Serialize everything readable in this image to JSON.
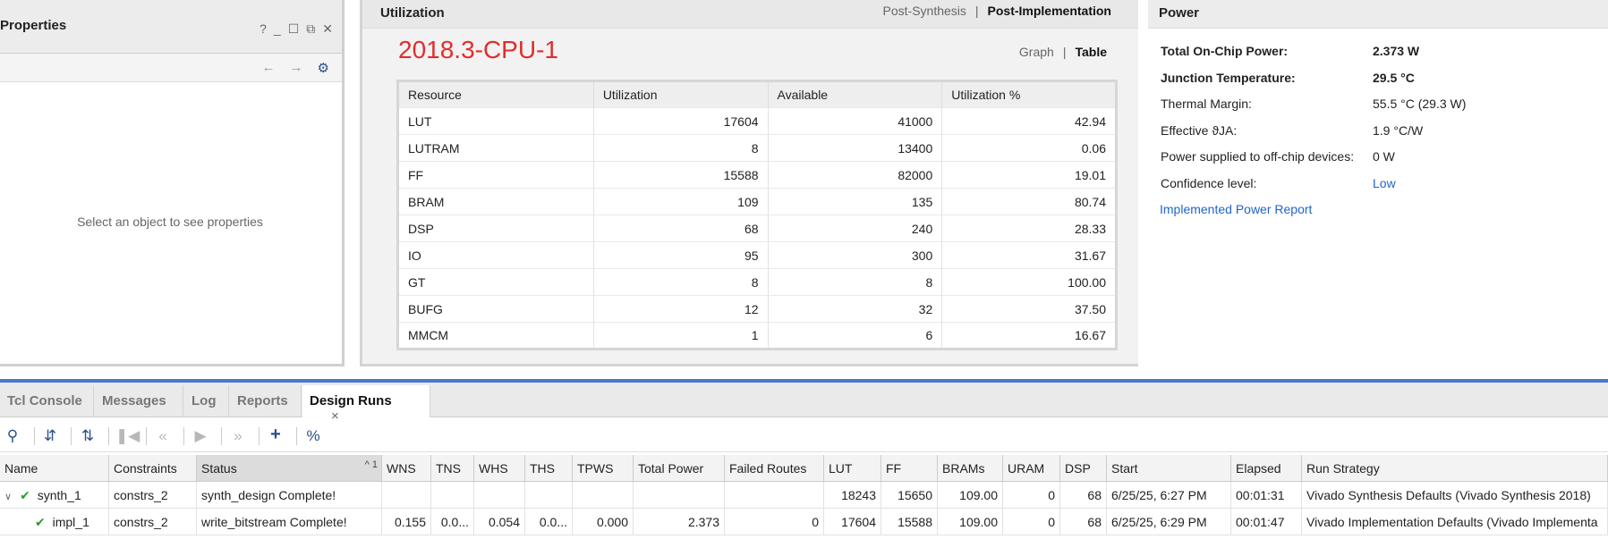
{
  "properties": {
    "title": "Properties",
    "empty_text": "Select an object to see properties",
    "win_buttons": [
      "?",
      "_",
      "☐",
      "⧉",
      "✕"
    ]
  },
  "utilization": {
    "title": "Utilization",
    "tabs": [
      "Post-Synthesis",
      "Post-Implementation"
    ],
    "active_tab": "Post-Implementation",
    "part_label": "2018.3-CPU-1",
    "view_modes": [
      "Graph",
      "Table"
    ],
    "active_view": "Table",
    "columns": [
      "Resource",
      "Utilization",
      "Available",
      "Utilization %"
    ],
    "rows": [
      [
        "LUT",
        "17604",
        "41000",
        "42.94"
      ],
      [
        "LUTRAM",
        "8",
        "13400",
        "0.06"
      ],
      [
        "FF",
        "15588",
        "82000",
        "19.01"
      ],
      [
        "BRAM",
        "109",
        "135",
        "80.74"
      ],
      [
        "DSP",
        "68",
        "240",
        "28.33"
      ],
      [
        "IO",
        "95",
        "300",
        "31.67"
      ],
      [
        "GT",
        "8",
        "8",
        "100.00"
      ],
      [
        "BUFG",
        "12",
        "32",
        "37.50"
      ],
      [
        "MMCM",
        "1",
        "6",
        "16.67"
      ]
    ]
  },
  "power": {
    "title": "Power",
    "items": [
      {
        "label": "Total On-Chip Power:",
        "value": "2.373 W",
        "bold": true
      },
      {
        "label": "Junction Temperature:",
        "value": "29.5 °C",
        "bold": true
      },
      {
        "label": "Thermal Margin:",
        "value": "55.5 °C (29.3 W)"
      },
      {
        "label": "Effective ϑJA:",
        "value": "1.9 °C/W"
      },
      {
        "label": "Power supplied to off-chip devices:",
        "value": "0 W"
      },
      {
        "label": "Confidence level:",
        "value": "Low",
        "link": true
      }
    ],
    "report_link": "Implemented Power Report"
  },
  "bottom_tabs": [
    "Tcl Console",
    "Messages",
    "Log",
    "Reports",
    "Design Runs"
  ],
  "active_bottom_tab": "Design Runs",
  "close_glyph": "×",
  "toolbar_icons": [
    "search-icon",
    "collapse-all-icon",
    "expand-all-icon",
    "first-icon",
    "previous-icon",
    "run-icon",
    "next-icon",
    "add-icon",
    "percent-icon"
  ],
  "toolbar_glyphs": {
    "percent": "%",
    "add": "+"
  },
  "runs": {
    "sort_indicator": "^ 1",
    "columns": [
      "Name",
      "Constraints",
      "Status",
      "WNS",
      "TNS",
      "WHS",
      "THS",
      "TPWS",
      "Total Power",
      "Failed Routes",
      "LUT",
      "FF",
      "BRAMs",
      "URAM",
      "DSP",
      "Start",
      "Elapsed",
      "Run Strategy"
    ],
    "rows": [
      {
        "name": "synth_1",
        "constraints": "constrs_2",
        "status": "synth_design Complete!",
        "wns": "",
        "tns": "",
        "whs": "",
        "ths": "",
        "tpws": "",
        "power": "",
        "failed": "",
        "lut": "18243",
        "ff": "15650",
        "brams": "109.00",
        "uram": "0",
        "dsp": "68",
        "start": "6/25/25, 6:27 PM",
        "elapsed": "00:01:31",
        "strategy": "Vivado Synthesis Defaults (Vivado Synthesis 2018)"
      },
      {
        "name": "impl_1",
        "constraints": "constrs_2",
        "status": "write_bitstream Complete!",
        "wns": "0.155",
        "tns": "0.0...",
        "whs": "0.054",
        "ths": "0.0...",
        "tpws": "0.000",
        "power": "2.373",
        "failed": "0",
        "lut": "17604",
        "ff": "15588",
        "brams": "109.00",
        "uram": "0",
        "dsp": "68",
        "start": "6/25/25, 6:29 PM",
        "elapsed": "00:01:47",
        "strategy": "Vivado Implementation Defaults (Vivado Implementa"
      }
    ]
  }
}
